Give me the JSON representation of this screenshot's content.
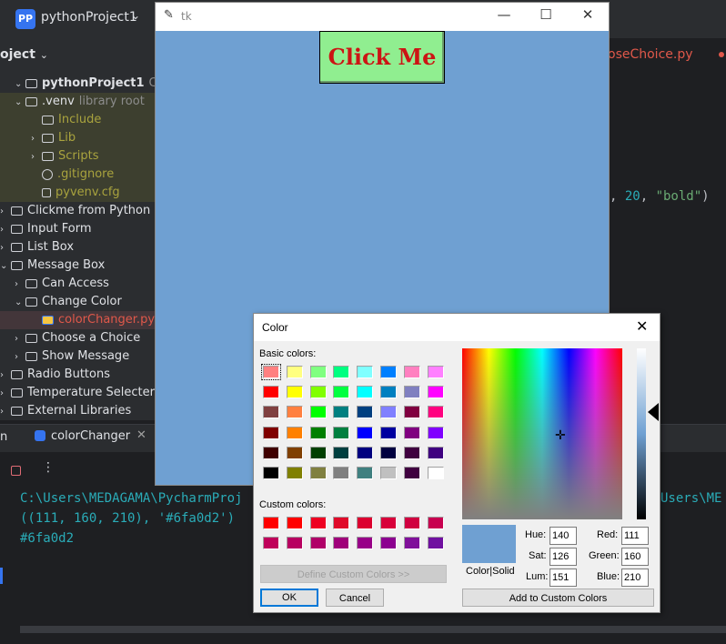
{
  "ide": {
    "badge": "PP",
    "project_name": "pythonProject1",
    "project_header": "oject",
    "tree": [
      {
        "label": "pythonProject1",
        "hint": "C:\\Users",
        "indent": 1,
        "chev": "⌄",
        "bold": true
      },
      {
        "label": ".venv",
        "hint": "library root",
        "indent": 1,
        "chev": "⌄"
      },
      {
        "label": "Include",
        "indent": 2,
        "chev": ""
      },
      {
        "label": "Lib",
        "indent": 2,
        "chev": "›"
      },
      {
        "label": "Scripts",
        "indent": 2,
        "chev": "›"
      },
      {
        "label": ".gitignore",
        "indent": 2,
        "chev": ""
      },
      {
        "label": "pyvenv.cfg",
        "indent": 2,
        "chev": ""
      },
      {
        "label": "Clickme from Python",
        "indent": 0,
        "chev": "›"
      },
      {
        "label": "Input Form",
        "indent": 0,
        "chev": "›"
      },
      {
        "label": "List Box",
        "indent": 0,
        "chev": "›"
      },
      {
        "label": "Message Box",
        "indent": 0,
        "chev": "⌄"
      },
      {
        "label": "Can Access",
        "indent": 1,
        "chev": "›"
      },
      {
        "label": "Change Color",
        "indent": 1,
        "chev": "⌄"
      },
      {
        "label": "colorChanger.py",
        "indent": 2,
        "chev": ""
      },
      {
        "label": "Choose a Choice",
        "indent": 1,
        "chev": "›"
      },
      {
        "label": "Show Message",
        "indent": 1,
        "chev": "›"
      },
      {
        "label": "Radio Buttons",
        "indent": 0,
        "chev": "›"
      },
      {
        "label": "Temperature Selecter",
        "indent": 0,
        "chev": "›"
      },
      {
        "label": "External Libraries",
        "indent": 0,
        "chev": "›"
      }
    ],
    "editor_tab": "oseChoice.py",
    "code_line": {
      "prefix": ", ",
      "num": "20",
      "sep": ", ",
      "str": "\"bold\"",
      "suffix": ")"
    },
    "run_tab": "colorChanger",
    "run_prefix": "n",
    "console": [
      "C:\\Users\\MEDAGAMA\\PycharmProj",
      "((111, 160, 210), '#6fa0d2')",
      "#6fa0d2"
    ],
    "console_right": "Users\\ME"
  },
  "tk": {
    "title": "tk",
    "button_label": "Click Me",
    "bg_color": "#6fa0d2"
  },
  "color_dialog": {
    "title": "Color",
    "basic_label": "Basic colors:",
    "custom_label": "Custom colors:",
    "basic_colors": [
      "#ff8080",
      "#ffff80",
      "#80ff80",
      "#00ff80",
      "#80ffff",
      "#0080ff",
      "#ff80c0",
      "#ff80ff",
      "#ff0000",
      "#ffff00",
      "#80ff00",
      "#00ff40",
      "#00ffff",
      "#0080c0",
      "#8080c0",
      "#ff00ff",
      "#804040",
      "#ff8040",
      "#00ff00",
      "#008080",
      "#004080",
      "#8080ff",
      "#800040",
      "#ff0080",
      "#800000",
      "#ff8000",
      "#008000",
      "#008040",
      "#0000ff",
      "#0000a0",
      "#800080",
      "#8000ff",
      "#400000",
      "#804000",
      "#004000",
      "#004040",
      "#000080",
      "#000040",
      "#400040",
      "#400080",
      "#000000",
      "#808000",
      "#808040",
      "#808080",
      "#408080",
      "#c0c0c0",
      "#400040",
      "#ffffff"
    ],
    "custom_colors": [
      "#ff0000",
      "#ff0000",
      "#ee0022",
      "#e00a2a",
      "#dc0030",
      "#d8003a",
      "#d00040",
      "#c80050",
      "#c0005a",
      "#b80060",
      "#b00068",
      "#a0007a",
      "#980088",
      "#8c0090",
      "#80109a",
      "#7010a0"
    ],
    "define_custom": "Define Custom Colors >>",
    "ok": "OK",
    "cancel": "Cancel",
    "add_custom": "Add to Custom Colors",
    "color_solid": "Color|Solid",
    "hue_label": "Hue:",
    "hue": "140",
    "sat_label": "Sat:",
    "sat": "126",
    "lum_label": "Lum:",
    "lum": "151",
    "red_label": "Red:",
    "red": "111",
    "green_label": "Green:",
    "green": "160",
    "blue_label": "Blue:",
    "blue": "210",
    "current_color": "#6fa0d2"
  }
}
